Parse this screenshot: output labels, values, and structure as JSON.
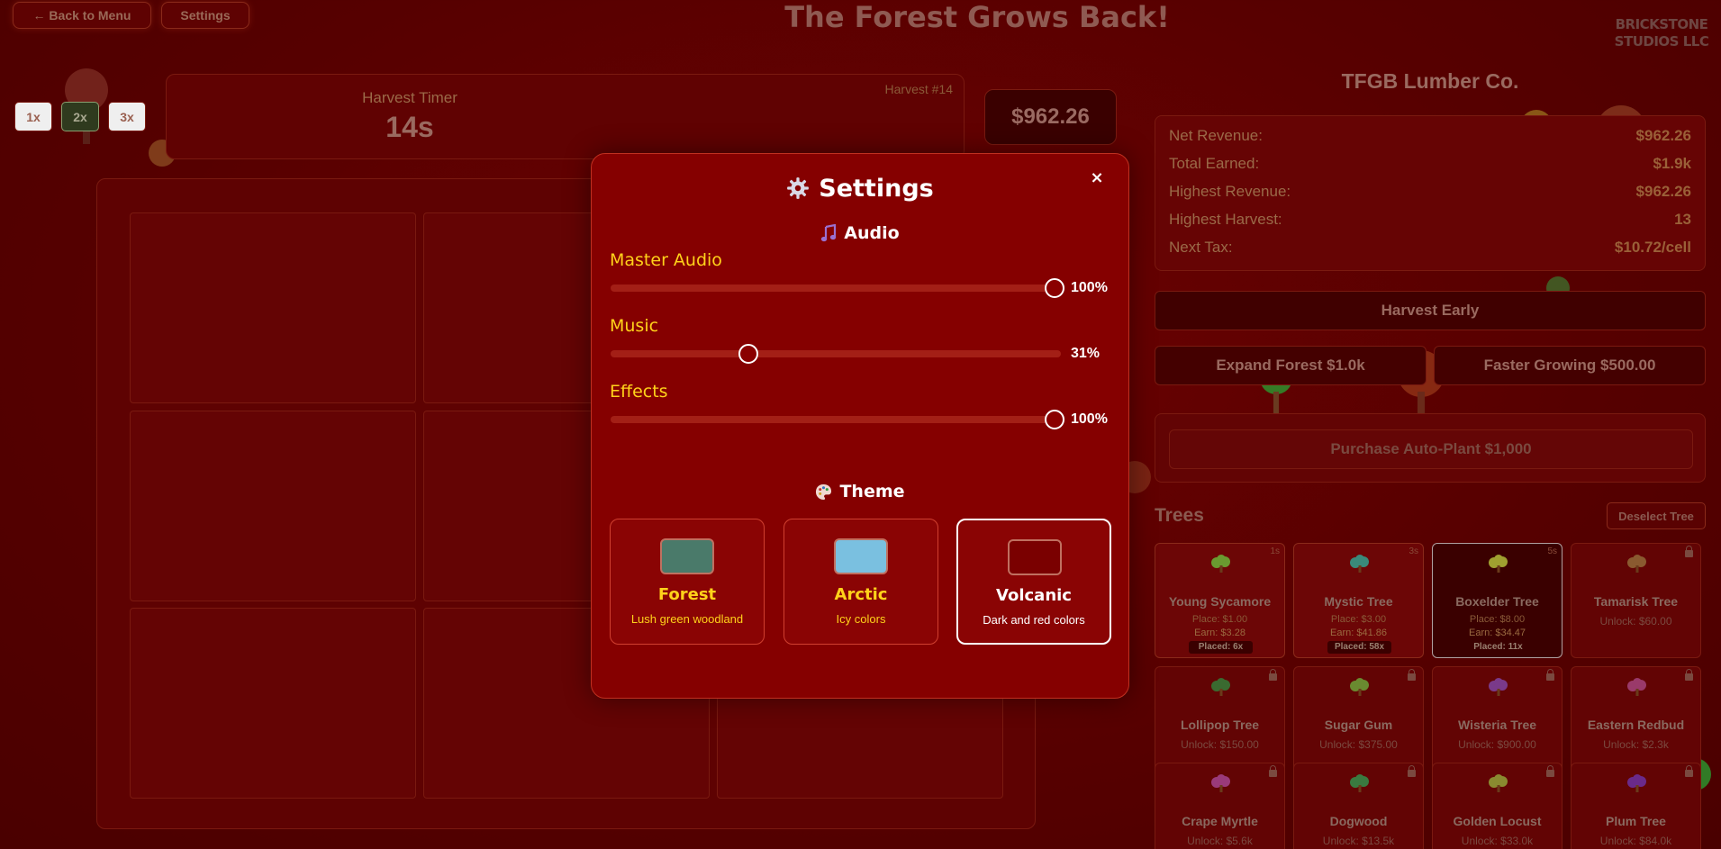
{
  "header": {
    "back_label": "← Back to Menu",
    "settings_label": "Settings",
    "title": "The Forest Grows Back!",
    "brand_line1": "BRICKSTONE",
    "brand_line2": "STUDIOS LLC"
  },
  "speed": {
    "options": [
      "1x",
      "2x",
      "3x"
    ],
    "selected": "2x"
  },
  "timer": {
    "label": "Harvest Timer",
    "value": "14s",
    "harvest_number": "Harvest #14"
  },
  "money": "$962.26",
  "company": {
    "name": "TFGB Lumber Co.",
    "stats": [
      {
        "label": "Net Revenue:",
        "value": "$962.26"
      },
      {
        "label": "Total Earned:",
        "value": "$1.9k"
      },
      {
        "label": "Highest Revenue:",
        "value": "$962.26"
      },
      {
        "label": "Highest Harvest:",
        "value": "13"
      },
      {
        "label": "Next Tax:",
        "value": "$10.72/cell"
      }
    ]
  },
  "actions": {
    "harvest_early": "Harvest Early",
    "expand_forest": "Expand Forest $1.0k",
    "faster_growing": "Faster Growing $500.00",
    "auto_plant": "Purchase Auto-Plant $1,000"
  },
  "trees": {
    "title": "Trees",
    "deselect_label": "Deselect Tree",
    "cards": [
      {
        "name": "Young Sycamore",
        "place": "Place: $1.00",
        "earn": "Earn: $3.28",
        "placed": "Placed: 6x",
        "time": "1s",
        "icon_color": "#6a9a30"
      },
      {
        "name": "Mystic Tree",
        "place": "Place: $3.00",
        "earn": "Earn: $41.86",
        "placed": "Placed: 58x",
        "time": "3s",
        "icon_color": "#3a8a7a"
      },
      {
        "name": "Boxelder Tree",
        "place": "Place: $8.00",
        "earn": "Earn: $34.47",
        "placed": "Placed: 11x",
        "time": "5s",
        "icon_color": "#a0a030"
      },
      {
        "name": "Tamarisk Tree",
        "unlock": "Unlock: $60.00",
        "icon_color": "#8a5a30"
      },
      {
        "name": "Lollipop Tree",
        "unlock": "Unlock: $150.00",
        "icon_color": "#3a6a30"
      },
      {
        "name": "Sugar Gum",
        "unlock": "Unlock: $375.00",
        "icon_color": "#6a8a30"
      },
      {
        "name": "Wisteria Tree",
        "unlock": "Unlock: $900.00",
        "icon_color": "#7a3a8a"
      },
      {
        "name": "Eastern Redbud",
        "unlock": "Unlock: $2.3k",
        "icon_color": "#9a3a6a"
      },
      {
        "name": "Crape Myrtle",
        "unlock": "Unlock: $5.6k",
        "icon_color": "#9a3a7a"
      },
      {
        "name": "Dogwood",
        "unlock": "Unlock: $13.5k",
        "icon_color": "#3a7a40"
      },
      {
        "name": "Golden Locust",
        "unlock": "Unlock: $33.0k",
        "icon_color": "#8a8a30"
      },
      {
        "name": "Plum Tree",
        "unlock": "Unlock: $84.0k",
        "icon_color": "#6a2a8a"
      }
    ]
  },
  "settings_modal": {
    "title": "Settings",
    "close_label": "×",
    "audio_title": "Audio",
    "sliders": [
      {
        "label": "Master Audio",
        "value": 100,
        "display": "100%"
      },
      {
        "label": "Music",
        "value": 31,
        "display": "31%"
      },
      {
        "label": "Effects",
        "value": 100,
        "display": "100%"
      }
    ],
    "theme_title": "Theme",
    "themes": [
      {
        "name": "Forest",
        "desc": "Lush green woodland",
        "swatch": "#4a7a6a",
        "selected": false
      },
      {
        "name": "Arctic",
        "desc": "Icy colors",
        "swatch": "#7ac0e0",
        "selected": false
      },
      {
        "name": "Volcanic",
        "desc": "Dark and red colors",
        "swatch": "#7a0000",
        "selected": true
      }
    ]
  }
}
